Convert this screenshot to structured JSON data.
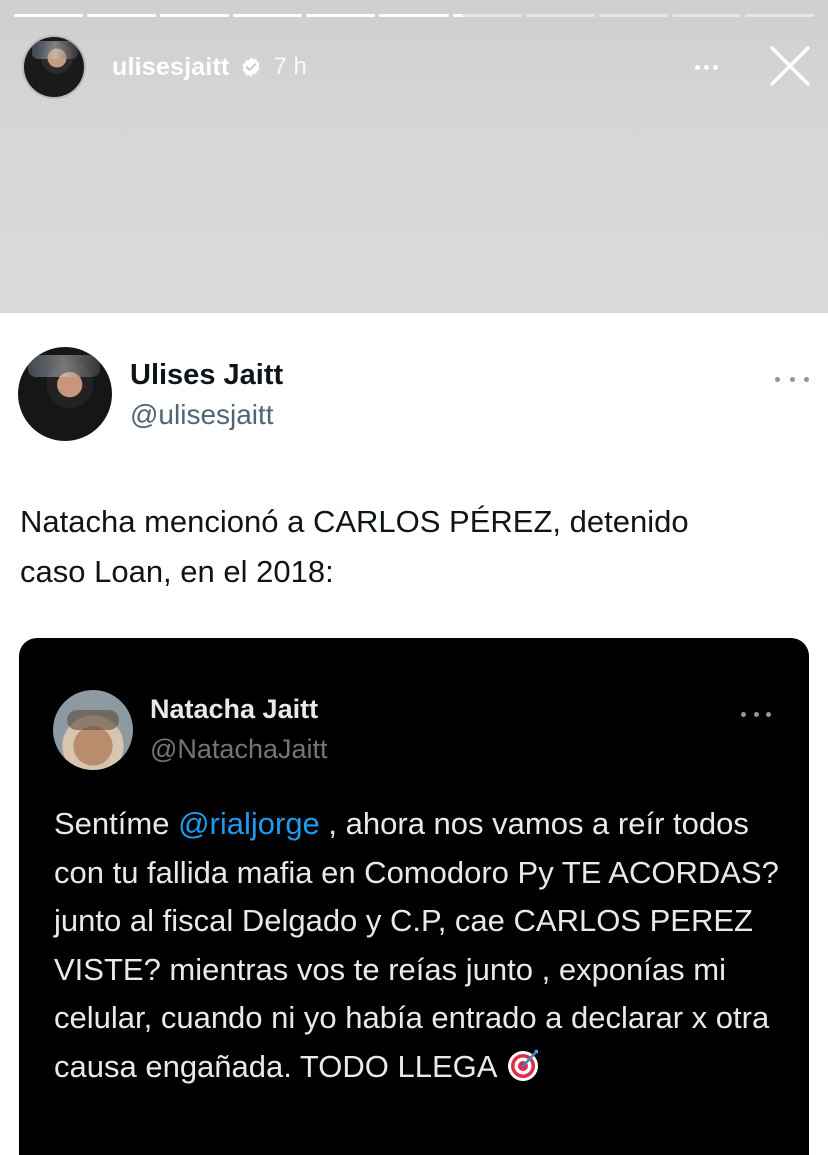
{
  "story": {
    "progress_segments": [
      1,
      1,
      1,
      1,
      1,
      1,
      0.15,
      0,
      0,
      0,
      0
    ],
    "username": "ulisesjaitt",
    "time": "7 h",
    "more_icon": "more-horizontal-icon",
    "close_icon": "close-icon",
    "verified_icon": "verified-badge-icon"
  },
  "tweet": {
    "author_name": "Ulises Jaitt",
    "author_handle": "@ulisesjaitt",
    "text_line1": "Natacha mencionó a CARLOS PÉREZ, detenido",
    "text_line2": "caso Loan, en el 2018:",
    "quoted": {
      "author_name": "Natacha Jaitt",
      "author_handle": "@NatachaJaitt",
      "text_before_mention": "Sentíme ",
      "mention": "@rialjorge",
      "text_after_mention": " , ahora nos vamos a reír todos con tu fallida mafia en Comodoro Py TE ACORDAS?  junto al fiscal Delgado y C.P,  cae CARLOS PEREZ VISTE? mientras vos te reías junto , exponías mi celular, cuando ni yo había entrado a declarar x otra causa engañada. TODO LLEGA",
      "emoji_icon": "direct-hit-target-icon"
    }
  },
  "colors": {
    "mention": "#1d9bf0",
    "name_light": "#0f1419",
    "handle_light": "#536471",
    "quote_bg": "#000000"
  }
}
